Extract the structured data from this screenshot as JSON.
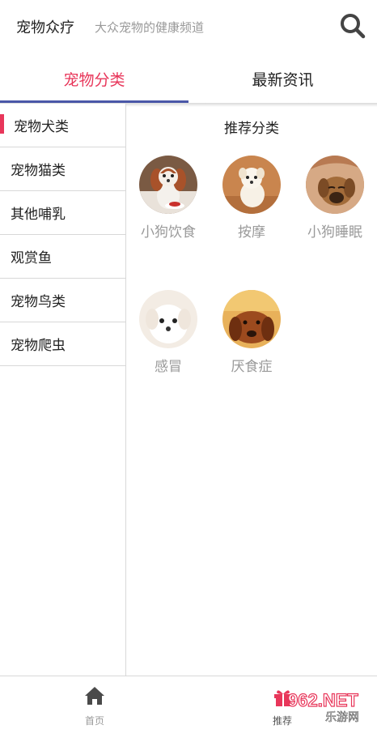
{
  "header": {
    "title": "宠物众疗",
    "subtitle": "大众宠物的健康频道",
    "search_icon": "search-icon"
  },
  "tabs": [
    {
      "label": "宠物分类",
      "active": true
    },
    {
      "label": "最新资讯",
      "active": false
    }
  ],
  "colors": {
    "accent": "#e8365a",
    "tab_indicator": "#4a57a8",
    "muted_text": "#9a9a9a",
    "divider": "#d8d8d8"
  },
  "sidebar": {
    "items": [
      {
        "label": "宠物犬类",
        "active": true
      },
      {
        "label": "宠物猫类",
        "active": false
      },
      {
        "label": "其他哺乳",
        "active": false
      },
      {
        "label": "观赏鱼",
        "active": false
      },
      {
        "label": "宠物鸟类",
        "active": false
      },
      {
        "label": "宠物爬虫",
        "active": false
      }
    ]
  },
  "content": {
    "section_title": "推荐分类",
    "items": [
      {
        "label": "小狗饮食"
      },
      {
        "label": "按摩"
      },
      {
        "label": "小狗睡眠"
      },
      {
        "label": "感冒"
      },
      {
        "label": "厌食症"
      }
    ]
  },
  "bottom_nav": {
    "items": [
      {
        "label": "首页",
        "icon": "home-icon"
      },
      {
        "label": "推荐",
        "icon": "gift-icon"
      }
    ]
  },
  "watermark": {
    "text": "962.NET",
    "subtext": "乐游网"
  }
}
